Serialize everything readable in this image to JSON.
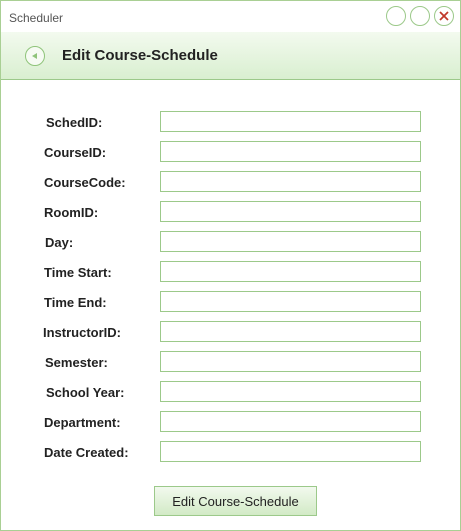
{
  "window": {
    "title": "Scheduler",
    "controls": [
      "minimize-icon",
      "maximize-icon",
      "close-icon"
    ]
  },
  "header": {
    "title": "Edit Course-Schedule",
    "back_icon": "back-arrow-icon"
  },
  "form": {
    "fields": [
      {
        "label": "SchedID:",
        "value": ""
      },
      {
        "label": "CourseID:",
        "value": ""
      },
      {
        "label": "CourseCode:",
        "value": ""
      },
      {
        "label": "RoomID:",
        "value": ""
      },
      {
        "label": "Day:",
        "value": ""
      },
      {
        "label": "Time Start:",
        "value": ""
      },
      {
        "label": "Time End:",
        "value": ""
      },
      {
        "label": "InstructorID:",
        "value": ""
      },
      {
        "label": "Semester:",
        "value": ""
      },
      {
        "label": "School Year:",
        "value": ""
      },
      {
        "label": "Department:",
        "value": ""
      },
      {
        "label": "Date Created:",
        "value": ""
      }
    ],
    "submit_label": "Edit Course-Schedule"
  },
  "colors": {
    "accent": "#9cc98a",
    "header_gradient_top": "#f3faef",
    "header_gradient_bottom": "#d9efd0",
    "close_accent": "#c0392b"
  }
}
